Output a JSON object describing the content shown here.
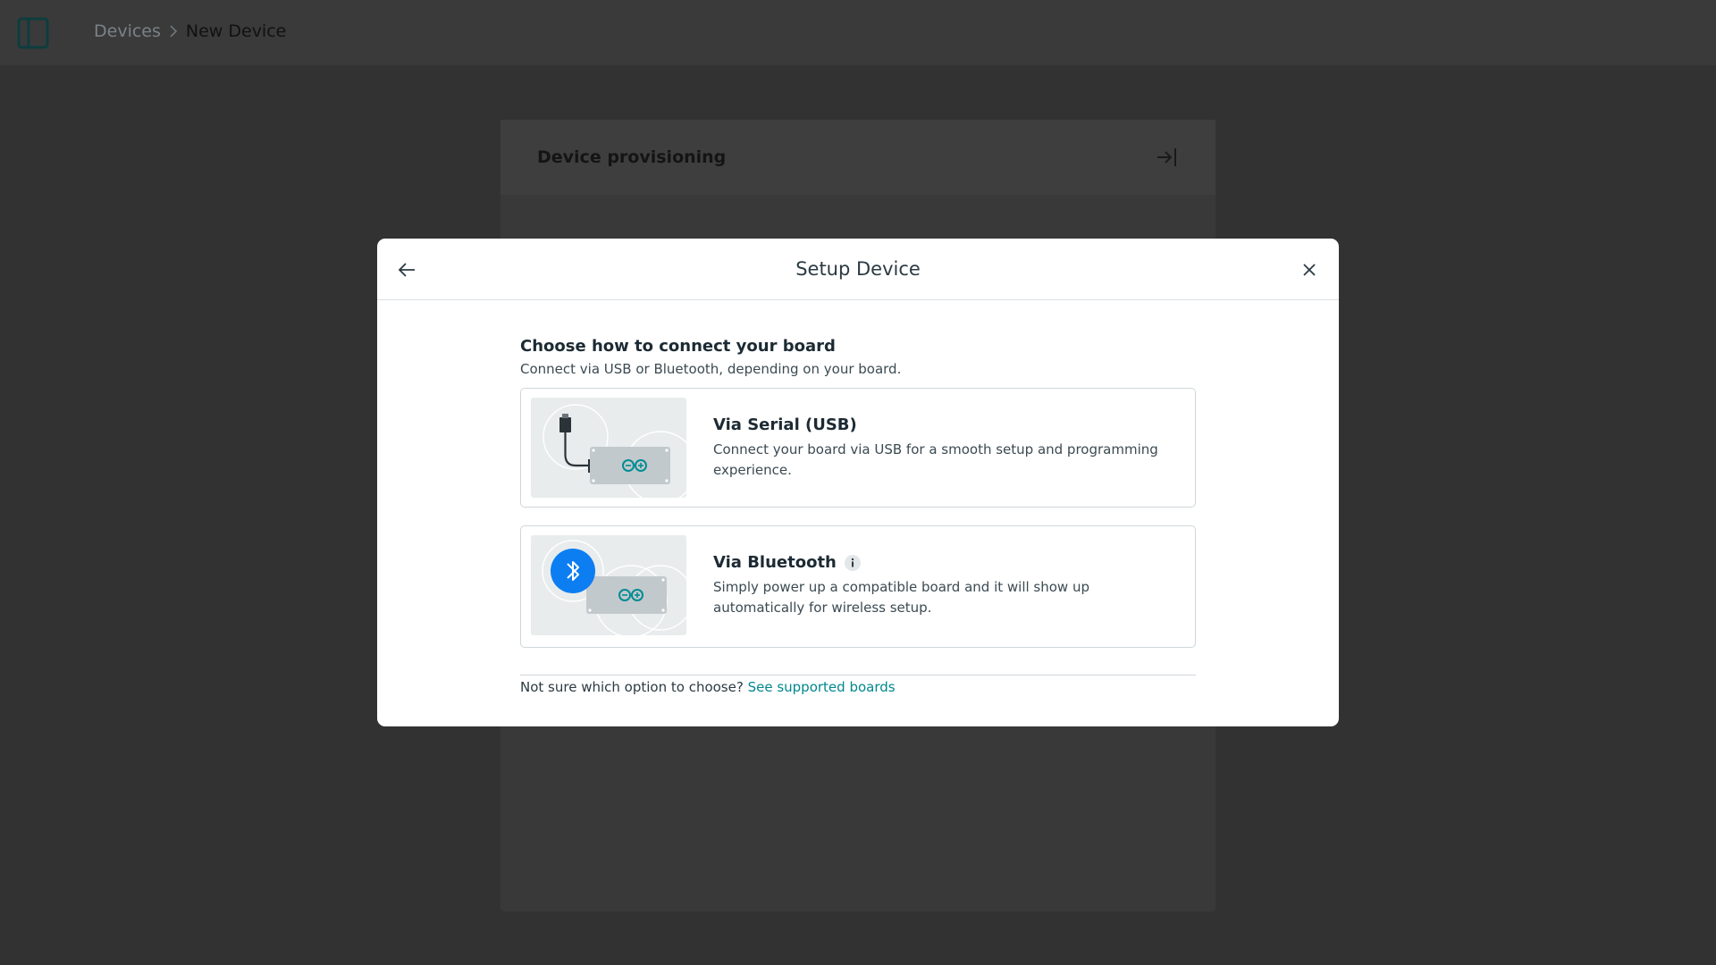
{
  "breadcrumb": {
    "devices": "Devices",
    "current": "New Device"
  },
  "background_panel": {
    "title": "Device provisioning"
  },
  "modal": {
    "title": "Setup Device",
    "heading": "Choose how to connect your board",
    "subheading": "Connect via USB or Bluetooth, depending on your board.",
    "options": [
      {
        "title": "Via Serial (USB)",
        "description": "Connect your board via USB for a smooth setup and programming experience.",
        "icon": "usb-board-illustration"
      },
      {
        "title": "Via Bluetooth",
        "description": "Simply power up a compatible board and it will show up automatically for wireless setup.",
        "icon": "bluetooth-board-illustration"
      }
    ],
    "footer_text": "Not sure which option to choose?",
    "footer_link": "See supported boards"
  },
  "colors": {
    "accent": "#00878f",
    "bluetooth": "#0c7ef2",
    "overlay": "#323232"
  }
}
